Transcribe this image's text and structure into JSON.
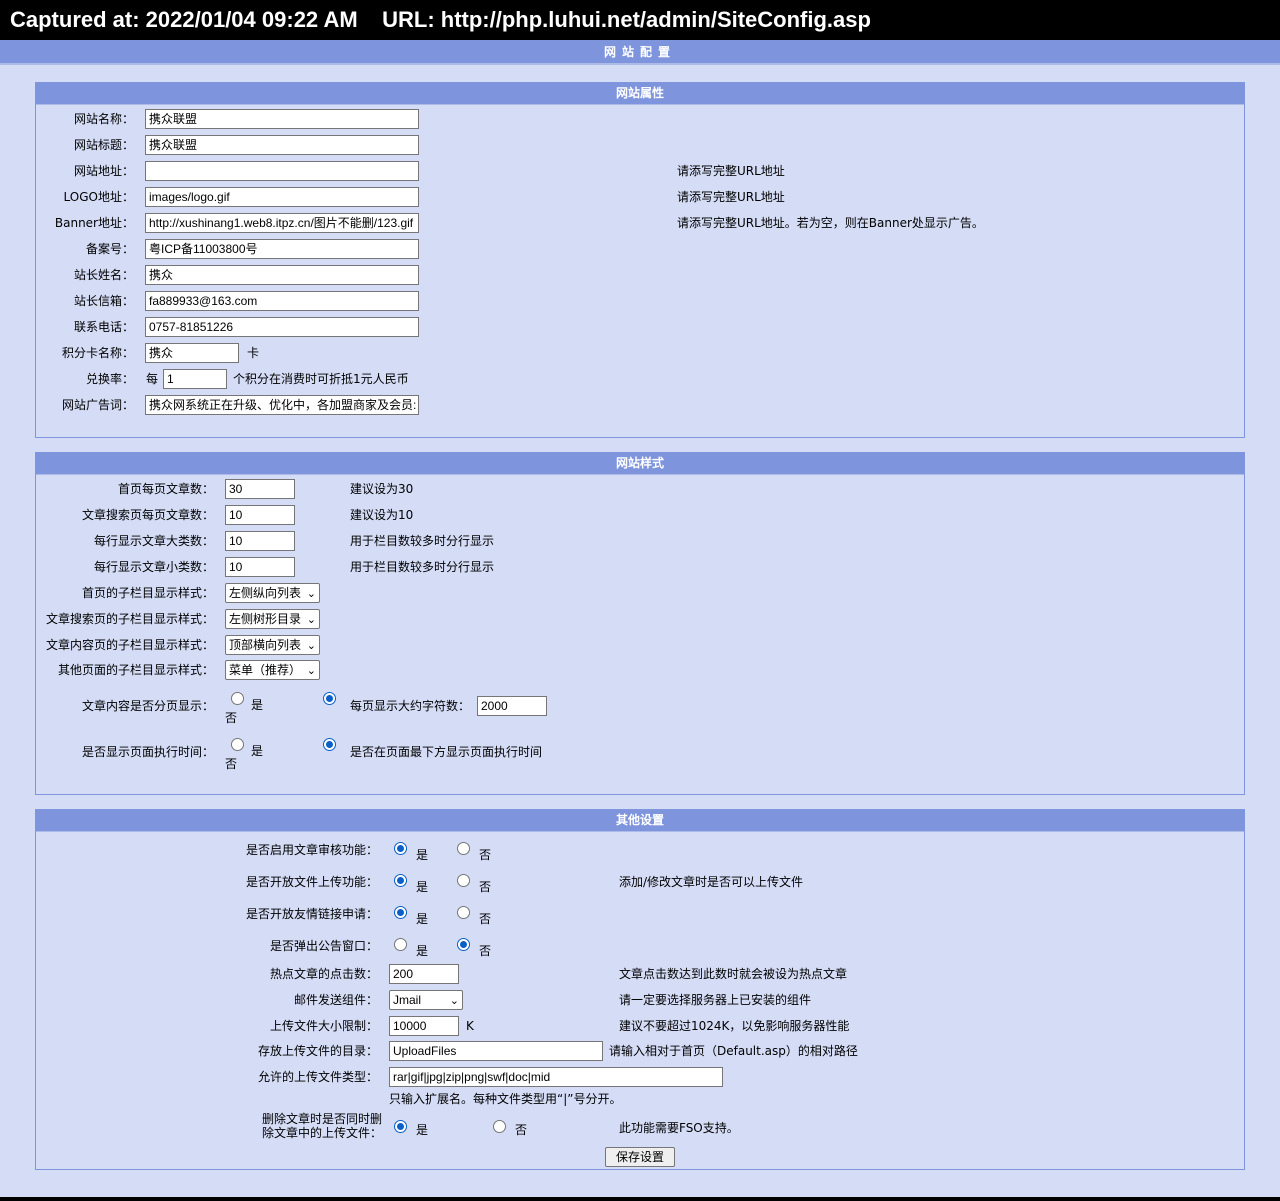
{
  "capture_bar": "Captured at: 2022/01/04 09:22 AM    URL: http://php.luhui.net/admin/SiteConfig.asp",
  "page_title": "网站配置",
  "site_props": {
    "header": "网站属性",
    "fields": [
      {
        "label": "网站名称：",
        "value": "携众联盟",
        "hint": ""
      },
      {
        "label": "网站标题：",
        "value": "携众联盟",
        "hint": ""
      },
      {
        "label": "网站地址：",
        "value": "",
        "hint": "请添写完整URL地址"
      },
      {
        "label": "LOGO地址：",
        "value": "images/logo.gif",
        "hint": "请添写完整URL地址"
      },
      {
        "label": "Banner地址：",
        "value": "http://xushinang1.web8.itpz.cn/图片不能删/123.gif",
        "hint": "请添写完整URL地址。若为空，则在Banner处显示广告。"
      },
      {
        "label": "备案号：",
        "value": "粤ICP备11003800号",
        "hint": ""
      },
      {
        "label": "站长姓名：",
        "value": "携众",
        "hint": ""
      },
      {
        "label": "站长信箱：",
        "value": "fa889933@163.com",
        "hint": ""
      },
      {
        "label": "联系电话：",
        "value": "0757-81851226",
        "hint": ""
      }
    ],
    "card": {
      "label": "积分卡名称：",
      "value": "携众",
      "suffix": "卡"
    },
    "rate": {
      "label": "兑换率：",
      "prefix": "每",
      "value": "1",
      "suffix": "个积分在消费时可折抵1元人民币"
    },
    "ad": {
      "label": "网站广告词：",
      "value": "携众网系统正在升级、优化中，各加盟商家及会员:"
    }
  },
  "site_style": {
    "header": "网站样式",
    "inputs": [
      {
        "label": "首页每页文章数：",
        "value": "30",
        "hint": "建议设为30"
      },
      {
        "label": "文章搜索页每页文章数：",
        "value": "10",
        "hint": "建议设为10"
      },
      {
        "label": "每行显示文章大类数：",
        "value": "10",
        "hint": "用于栏目数较多时分行显示"
      },
      {
        "label": "每行显示文章小类数：",
        "value": "10",
        "hint": "用于栏目数较多时分行显示"
      }
    ],
    "selects": [
      {
        "label": "首页的子栏目显示样式：",
        "value": "左侧纵向列表"
      },
      {
        "label": "文章搜索页的子栏目显示样式：",
        "value": "左侧树形目录"
      },
      {
        "label": "文章内容页的子栏目显示样式：",
        "value": "顶部横向列表"
      },
      {
        "label": "其他页面的子栏目显示样式：",
        "value": "菜单（推荐）"
      }
    ],
    "paging": {
      "label": "文章内容是否分页显示：",
      "yes": "是",
      "no": "否",
      "extra_label": "每页显示大约字符数：",
      "extra_value": "2000"
    },
    "exec_time": {
      "label": "是否显示页面执行时间：",
      "yes": "是",
      "no": "否",
      "hint": "是否在页面最下方显示页面执行时间"
    }
  },
  "other": {
    "header": "其他设置",
    "yes": "是",
    "no": "否",
    "audit": {
      "label": "是否启用文章审核功能：",
      "hint": ""
    },
    "upload": {
      "label": "是否开放文件上传功能：",
      "hint": "添加/修改文章时是否可以上传文件"
    },
    "links": {
      "label": "是否开放友情链接申请：",
      "hint": ""
    },
    "popup": {
      "label": "是否弹出公告窗口：",
      "hint": ""
    },
    "hot": {
      "label": "热点文章的点击数：",
      "value": "200",
      "hint": "文章点击数达到此数时就会被设为热点文章"
    },
    "mail": {
      "label": "邮件发送组件：",
      "value": "Jmail",
      "hint": "请一定要选择服务器上已安装的组件"
    },
    "size": {
      "label": "上传文件大小限制：",
      "value": "10000",
      "unit": "K",
      "hint": "建议不要超过1024K，以免影响服务器性能"
    },
    "dir": {
      "label": "存放上传文件的目录：",
      "value": "UploadFiles",
      "hint": "请输入相对于首页（Default.asp）的相对路径"
    },
    "types": {
      "label": "允许的上传文件类型：",
      "value": "rar|gif|jpg|zip|png|swf|doc|mid",
      "hint": "只输入扩展名。每种文件类型用“|”号分开。"
    },
    "delete": {
      "label1": "删除文章时是否同时删",
      "label2": "除文章中的上传文件：",
      "hint": "此功能需要FSO支持。"
    },
    "save_label": "保存设置"
  }
}
